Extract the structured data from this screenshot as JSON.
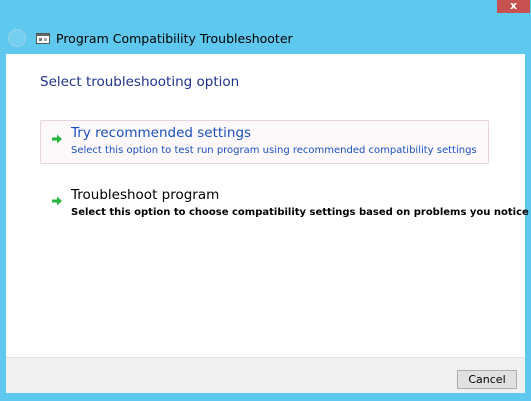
{
  "window": {
    "title": "Program Compatibility Troubleshooter",
    "close_label": "x"
  },
  "main": {
    "heading": "Select troubleshooting option",
    "options": [
      {
        "title": "Try recommended settings",
        "description": "Select this option to test run program using recommended compatibility settings",
        "icon": "green-arrow-icon"
      },
      {
        "title": "Troubleshoot program",
        "description": "Select this option to choose compatibility settings based on problems you notice",
        "icon": "green-arrow-icon"
      }
    ]
  },
  "footer": {
    "cancel_label": "Cancel"
  },
  "colors": {
    "title_bar": "#5ec8ee",
    "heading": "#1e3287",
    "link_hover": "#1a50b9",
    "arrow": "#28b43c",
    "close_button": "#c75050"
  }
}
